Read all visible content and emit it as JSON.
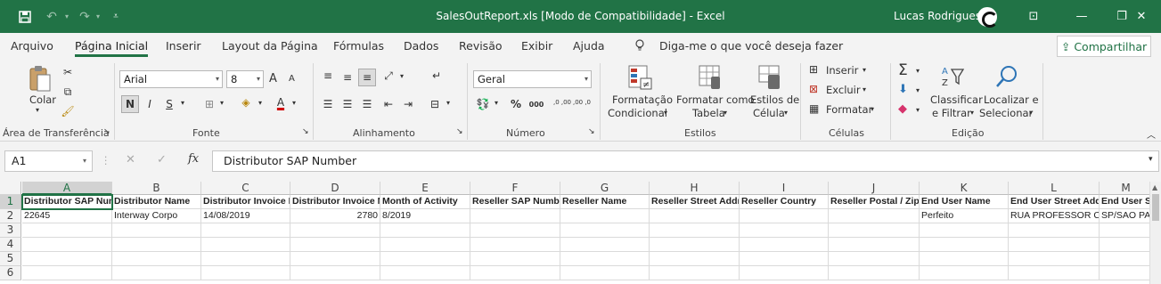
{
  "titlebar": {
    "title": "SalesOutReport.xls  [Modo de Compatibilidade]  -  Excel",
    "user": "Lucas Rodrigues",
    "save_icon": "floppy-icon",
    "min": "—",
    "max": "❐",
    "close": "✕",
    "ribbon_display": "⊡"
  },
  "tabs": [
    "Arquivo",
    "Página Inicial",
    "Inserir",
    "Layout da Página",
    "Fórmulas",
    "Dados",
    "Revisão",
    "Exibir",
    "Ajuda"
  ],
  "tell_me": "Diga-me o que você deseja fazer",
  "share": "Compartilhar",
  "ribbon": {
    "clipboard": {
      "paste": "Colar",
      "label": "Área de Transferência"
    },
    "font": {
      "name": "Arial",
      "size": "8",
      "label": "Fonte",
      "bold": "N",
      "italic": "I",
      "underline": "S",
      "inc": "A",
      "dec": "A"
    },
    "alignment": {
      "label": "Alinhamento"
    },
    "number": {
      "format": "Geral",
      "label": "Número",
      "pct": "%",
      "thousands": "000",
      "inc_dec": ",0 ,00",
      "dec_dec": ",00 ,0"
    },
    "styles": {
      "cond1": "Formatação",
      "cond2": "Condicional",
      "table1": "Formatar como",
      "table2": "Tabela",
      "cell1": "Estilos de",
      "cell2": "Célula",
      "label": "Estilos"
    },
    "cells": {
      "insert": "Inserir",
      "delete": "Excluir",
      "format": "Formatar",
      "label": "Células"
    },
    "editing": {
      "sort1": "Classificar",
      "sort2": "e Filtrar",
      "find1": "Localizar e",
      "find2": "Selecionar",
      "label": "Edição"
    }
  },
  "formula_bar": {
    "namebox": "A1",
    "content": "Distributor SAP Number"
  },
  "grid": {
    "columns": [
      "A",
      "B",
      "C",
      "D",
      "E",
      "F",
      "G",
      "H",
      "I",
      "J",
      "K",
      "L",
      "M"
    ],
    "rows": [
      "1",
      "2",
      "3",
      "4",
      "5",
      "6"
    ],
    "row1": [
      "Distributor SAP Number",
      "Distributor Name",
      "Distributor Invoice Date",
      "Distributor Invoice Number",
      "Month of Activity",
      "Reseller SAP Number",
      "Reseller Name",
      "Reseller Street Address",
      "Reseller Country",
      "Reseller Postal / Zip",
      "End User Name",
      "End User Street Address",
      "End User S"
    ],
    "row2": [
      "22645",
      "Interway Corpo",
      "14/08/2019",
      "2780",
      "8/2019",
      "",
      "",
      "",
      "",
      "",
      "Perfeito",
      "RUA PROFESSOR CEZ",
      "SP/SAO PA"
    ]
  }
}
